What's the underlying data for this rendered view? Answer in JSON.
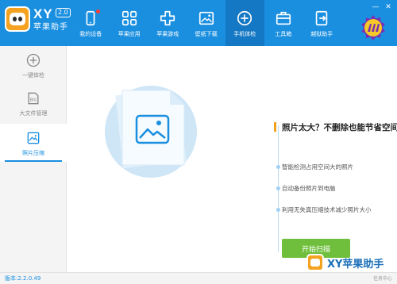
{
  "app": {
    "brand_xy": "XY",
    "version_badge": "2.0",
    "brand_name": "苹果助手"
  },
  "nav": [
    {
      "label": "我的设备",
      "icon": "phone-device-icon",
      "has_notification": true
    },
    {
      "label": "苹果应用",
      "icon": "apps-grid-icon",
      "has_notification": false
    },
    {
      "label": "苹果游戏",
      "icon": "gamepad-icon",
      "has_notification": false
    },
    {
      "label": "壁纸下载",
      "icon": "image-icon",
      "has_notification": false
    },
    {
      "label": "手机体检",
      "icon": "plus-circle-icon",
      "has_notification": false,
      "active": true
    },
    {
      "label": "工具箱",
      "icon": "toolbox-icon",
      "has_notification": false
    },
    {
      "label": "越狱助手",
      "icon": "exit-door-icon",
      "has_notification": false
    }
  ],
  "window_controls": [
    "—",
    "✕"
  ],
  "sidebar": [
    {
      "label": "一键体检",
      "icon": "plus-circle-icon"
    },
    {
      "label": "大文件管理",
      "icon": "big-file-icon"
    },
    {
      "label": "照片压缩",
      "icon": "photo-icon",
      "active": true
    }
  ],
  "main": {
    "headline": "照片太大？不删除也能节省空间！",
    "features": [
      "智能检测占用空间大的照片",
      "自动备份照片到电脑",
      "利用无失真压缩技术减少照片大小"
    ],
    "scan_button": "开始扫描"
  },
  "status": {
    "version": "版本:2.2.0.49",
    "task_center": "任务中心"
  },
  "watermark": {
    "text": "XY苹果助手"
  },
  "colors": {
    "header_blue": "#1a8fe0",
    "active_nav": "#1578c4",
    "accent_green": "#6fbf3c",
    "accent_orange": "#f0a020"
  }
}
